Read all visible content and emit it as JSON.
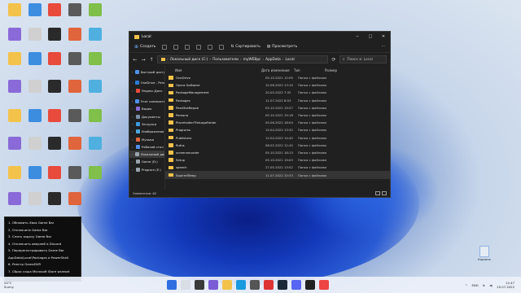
{
  "window": {
    "title": "Local",
    "toolbar": {
      "create_label": "Создать",
      "sort_label": "Сортировать",
      "view_label": "Просмотреть"
    },
    "address": {
      "parts": [
        "Локальный диск (C:)",
        "Пользователи",
        "myWEBpc",
        "AppData",
        "Local"
      ]
    },
    "search_placeholder": "Поиск в: Local",
    "sidebar": [
      "Быстрый доступ",
      "OneDrive - Personal",
      "Яндекс.Диск",
      "Этот компьютер",
      "Видео",
      "Документы",
      "Загрузки",
      "Изображения",
      "Музыка",
      "Рабочий стол",
      "Локальный диск (C:)",
      "Game (D:)",
      "Program (E:)"
    ],
    "columns": {
      "name": "Имя",
      "date": "Дата изменения",
      "type": "Тип",
      "size": "Размер"
    },
    "files": [
      {
        "name": "OneDrive",
        "date": "05.10.2021 12:09",
        "type": "Папка с файлами"
      },
      {
        "name": "Opera Software",
        "date": "10.06.2022 13:10",
        "type": "Папка с файлами"
      },
      {
        "name": "PackageManagement",
        "date": "20.05.2022 7:32",
        "type": "Папка с файлами"
      },
      {
        "name": "Packages",
        "date": "11.07.2022 8:53",
        "type": "Папка с файлами"
      },
      {
        "name": "PeerDistRepub",
        "date": "05.10.2021 19:27",
        "type": "Папка с файлами"
      },
      {
        "name": "Persona",
        "date": "05.10.2021 19:18",
        "type": "Папка с файлами"
      },
      {
        "name": "PlaceholderTileLogoFolder",
        "date": "05.06.2022 18:04",
        "type": "Папка с файлами"
      },
      {
        "name": "Programs",
        "date": "15.04.2022 13:32",
        "type": "Папка с файлами"
      },
      {
        "name": "Publishers",
        "date": "12.04.2022 14:45",
        "type": "Папка с файлами"
      },
      {
        "name": "Rufus",
        "date": "08.02.2022 12:45",
        "type": "Папка с файлами"
      },
      {
        "name": "screenrecorder",
        "date": "05.10.2021 18:13",
        "type": "Папка с файлами"
      },
      {
        "name": "Setup",
        "date": "05.10.2021 19:03",
        "type": "Папка с файлами"
      },
      {
        "name": "speech",
        "date": "27.05.2022 13:52",
        "type": "Папка с файлами"
      },
      {
        "name": "SquirrelTemp",
        "date": "11.07.2022 10:33",
        "type": "Папка с файлами"
      }
    ],
    "status": "Элементов: 62"
  },
  "instructions": [
    "1. Обновить Xbox Game Bar",
    "2. Отключите Game Bar",
    "3. Снять задачу Game Bar",
    "4. Отключить оверлей в Discord",
    "5. Перерегистрировать Game Bar",
    "AppData\\Local\\Packages и PowerShell",
    "6. Реестр GameDVR",
    "7. Сброс кэша Microsoft Store wsreset"
  ],
  "taskbar": {
    "weather_temp": "24°C",
    "weather_desc": "Sunny",
    "lang": "ENG",
    "time": "12:47",
    "date": "15.07.2022"
  },
  "recycle_label": "Корзина"
}
